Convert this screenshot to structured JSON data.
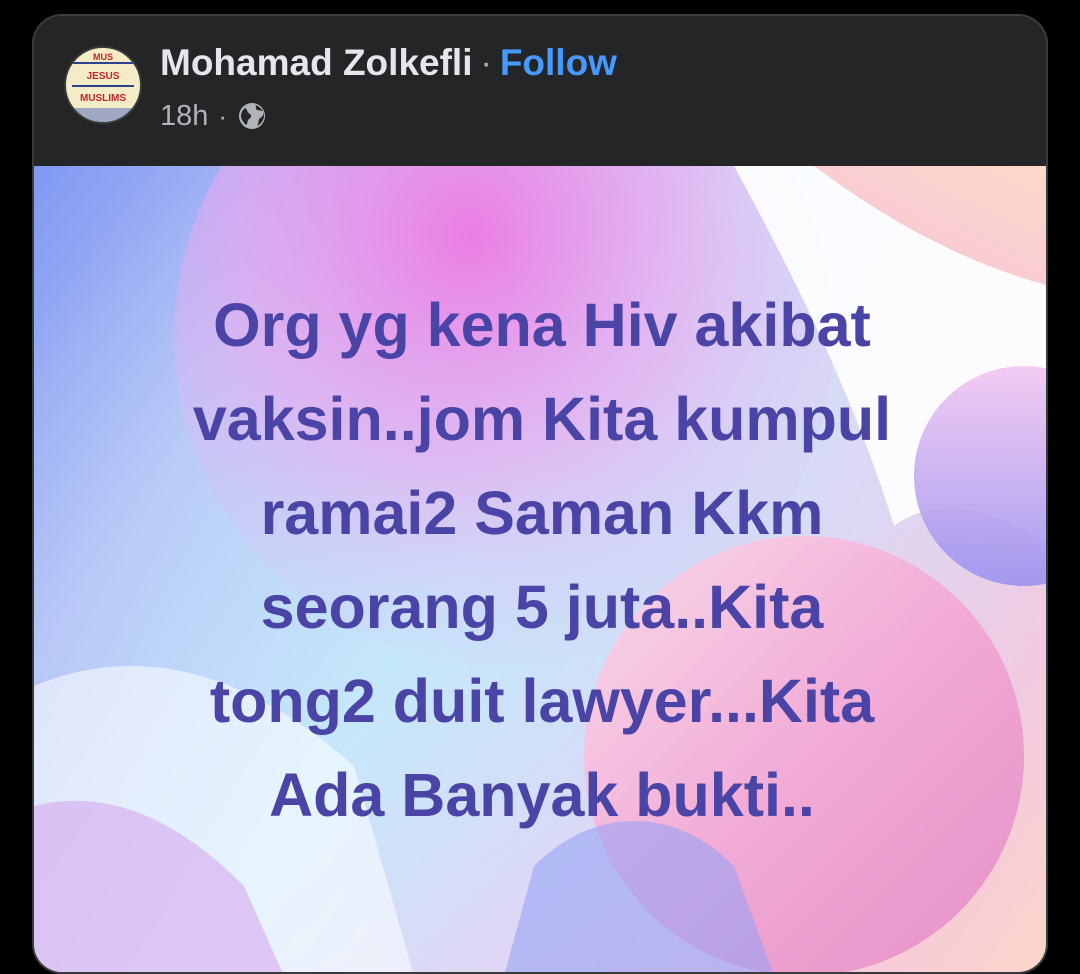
{
  "post": {
    "author": "Mohamad Zolkefli",
    "separator": "·",
    "follow_label": "Follow",
    "time": "18h",
    "meta_separator": "·",
    "audience_icon": "globe-icon",
    "avatar": {
      "lines": [
        "MUS",
        "JESUS",
        "MUSLIMS"
      ],
      "colors": {
        "red": "#c0272d",
        "blue": "#2d3f8f"
      }
    },
    "text_lines": [
      "Org yg kena Hiv akibat",
      "vaksin..jom Kita kumpul",
      "ramai2 Saman Kkm",
      "seorang 5 juta..Kita",
      "tong2 duit lawyer...Kita",
      "Ada Banyak bukti.."
    ]
  },
  "colors": {
    "card_bg": "#242526",
    "page_bg": "#000000",
    "name": "#e4e6eb",
    "follow": "#4599ff",
    "meta": "#b0b3b8",
    "post_text": "#4b44a7"
  }
}
